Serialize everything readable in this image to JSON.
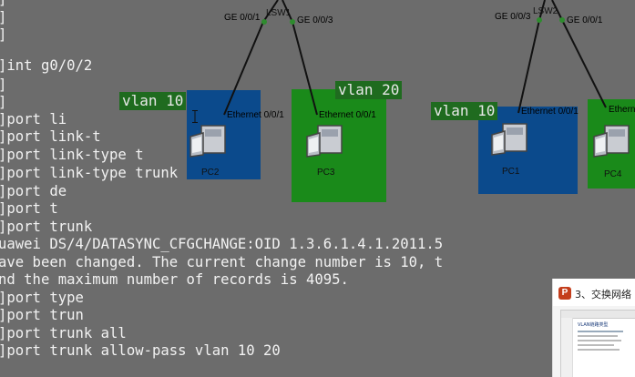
{
  "terminal": {
    "lines": [
      "]",
      "]",
      "]",
      "]int g0/0/2",
      "]",
      "]",
      "]port li",
      "]port link-t",
      "]port link-type t",
      "]port link-type trunk",
      "]port de",
      "]port t",
      "]port trunk",
      "uawei DS/4/DATASYNC_CFGCHANGE:OID 1.3.6.1.4.1.2011.5",
      "ave been changed. The current change number is 10, t",
      "nd the maximum number of records is 4095.",
      "]port type",
      "]port trun",
      "]port trunk all",
      "]port trunk allow-pass vlan 10 20"
    ]
  },
  "topology": {
    "switches": [
      {
        "name": "LSW1",
        "ports": [
          "GE 0/0/1",
          "GE 0/0/3"
        ]
      },
      {
        "name": "LSW2",
        "ports": [
          "GE 0/0/3",
          "GE 0/0/1"
        ]
      }
    ],
    "vlan_labels": [
      "vlan 10",
      "vlan 20",
      "vlan 10"
    ],
    "pcs": [
      {
        "name": "PC2",
        "port": "Ethernet 0/0/1"
      },
      {
        "name": "PC3",
        "port": "Ethernet 0/0/1"
      },
      {
        "name": "PC1",
        "port": "Ethernet 0/0/1"
      },
      {
        "name": "PC4",
        "port": "Etherne"
      }
    ],
    "colors": {
      "vlan10": "#0b4a8c",
      "vlan20": "#1a8a1a",
      "label_bg": "#1f6b1f"
    }
  },
  "taskbar_preview": {
    "app_icon": "powerpoint-icon",
    "app_letter": "P",
    "title": "3、交换网络",
    "slide_heading": "VLAN链路类型"
  }
}
